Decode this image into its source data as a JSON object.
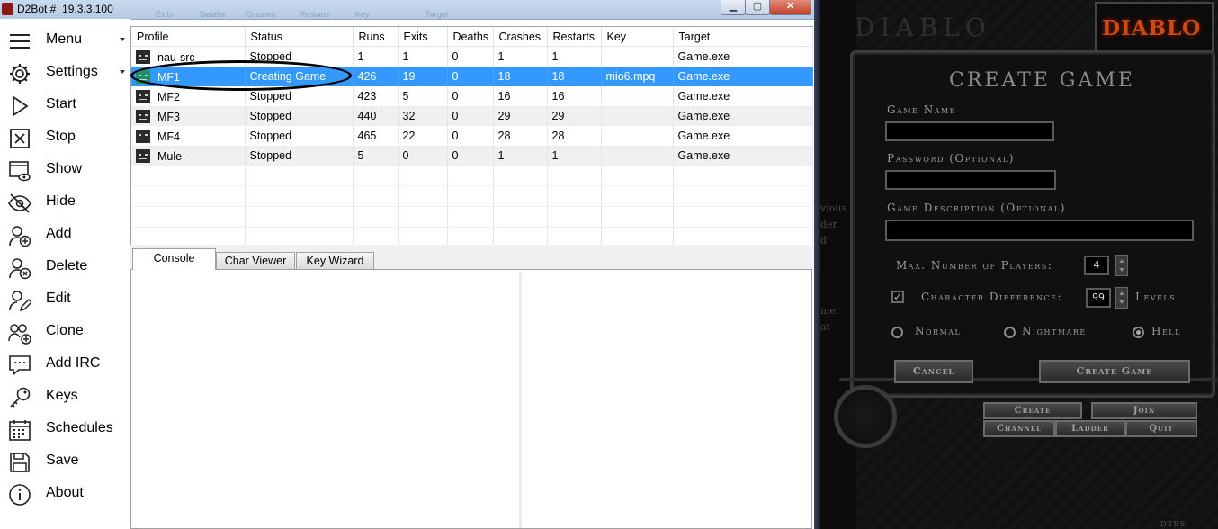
{
  "window": {
    "title": "D2Bot #  19.3.3.100",
    "behind_title_text": [
      "Exits",
      "Deaths",
      "Crashes",
      "Restarts",
      "Key",
      "Target"
    ],
    "controls": {
      "minimize": "▁",
      "maximize": "▢",
      "close": "✕"
    }
  },
  "sidebar": {
    "items": [
      {
        "label": "Menu",
        "icon": "hamburger-icon",
        "has_caret": true
      },
      {
        "label": "Settings",
        "icon": "gear-icon",
        "has_caret": true
      },
      {
        "label": "Start",
        "icon": "play-icon"
      },
      {
        "label": "Stop",
        "icon": "stop-box-icon"
      },
      {
        "label": "Show",
        "icon": "window-eye-icon"
      },
      {
        "label": "Hide",
        "icon": "eye-slash-icon"
      },
      {
        "label": "Add",
        "icon": "user-add-icon"
      },
      {
        "label": "Delete",
        "icon": "user-delete-icon"
      },
      {
        "label": "Edit",
        "icon": "user-edit-icon"
      },
      {
        "label": "Clone",
        "icon": "users-add-icon"
      },
      {
        "label": "Add IRC",
        "icon": "chat-icon"
      },
      {
        "label": "Keys",
        "icon": "key-icon"
      },
      {
        "label": "Schedules",
        "icon": "calendar-icon"
      },
      {
        "label": "Save",
        "icon": "floppy-icon"
      },
      {
        "label": "About",
        "icon": "info-icon"
      }
    ]
  },
  "profiles": {
    "columns": [
      "Profile",
      "Status",
      "Runs",
      "Exits",
      "Deaths",
      "Crashes",
      "Restarts",
      "Key",
      "Target"
    ],
    "rows": [
      {
        "profile": "nau-src",
        "status": "Stopped",
        "runs": "1",
        "exits": "1",
        "deaths": "0",
        "crashes": "1",
        "restarts": "1",
        "key": "",
        "target": "Game.exe"
      },
      {
        "profile": "MF1",
        "status": "Creating Game",
        "runs": "426",
        "exits": "19",
        "deaths": "0",
        "crashes": "18",
        "restarts": "18",
        "key": "mio6.mpq",
        "target": "Game.exe",
        "selected": true
      },
      {
        "profile": "MF2",
        "status": "Stopped",
        "runs": "423",
        "exits": "5",
        "deaths": "0",
        "crashes": "16",
        "restarts": "16",
        "key": "",
        "target": "Game.exe"
      },
      {
        "profile": "MF3",
        "status": "Stopped",
        "runs": "440",
        "exits": "32",
        "deaths": "0",
        "crashes": "29",
        "restarts": "29",
        "key": "",
        "target": "Game.exe"
      },
      {
        "profile": "MF4",
        "status": "Stopped",
        "runs": "465",
        "exits": "22",
        "deaths": "0",
        "crashes": "28",
        "restarts": "28",
        "key": "",
        "target": "Game.exe"
      },
      {
        "profile": "Mule",
        "status": "Stopped",
        "runs": "5",
        "exits": "0",
        "deaths": "0",
        "crashes": "1",
        "restarts": "1",
        "key": "",
        "target": "Game.exe"
      }
    ]
  },
  "tabs": [
    {
      "label": "Console",
      "active": true
    },
    {
      "label": "Char Viewer"
    },
    {
      "label": "Key Wizard"
    }
  ],
  "d2": {
    "header_text": "DIABLO",
    "logo": "DIABLO",
    "background_fragments": [
      "vious",
      "der",
      "d",
      "me.",
      "at"
    ],
    "title": "CREATE GAME",
    "game_name_label": "Game Name",
    "password_label": "Password (Optional)",
    "description_label": "Game Description (Optional)",
    "max_players_label": "Max. Number of Players:",
    "max_players_value": "4",
    "char_diff_label": "Character Difference:",
    "char_diff_value": "99",
    "levels_label": "Levels",
    "difficulty": {
      "normal": "Normal",
      "nightmare": "Nightmare",
      "hell": "Hell",
      "selected": "hell"
    },
    "cancel": "Cancel",
    "create_game": "Create Game",
    "menu": {
      "create": "Create",
      "join": "Join",
      "channel": "Channel",
      "ladder": "Ladder",
      "quit": "Quit"
    },
    "corner_text": "D2BS"
  }
}
